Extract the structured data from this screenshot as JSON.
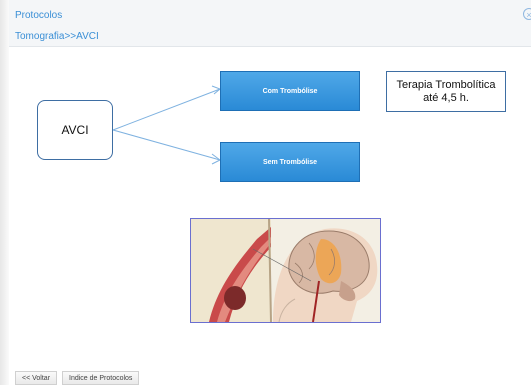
{
  "header": {
    "title": "Protocolos",
    "breadcrumb": "Tomografia>>AVCI",
    "close_icon": "close-circle-icon"
  },
  "diagram": {
    "root_label": "AVCI",
    "branch_com_label": "Com Trombólise",
    "branch_sem_label": "Sem Trombólise",
    "note_line1": "Terapia Trombolítica",
    "note_line2": "até 4,5 h.",
    "image_subject": "brain-stroke-illustration"
  },
  "footer": {
    "back_label": "<< Voltar",
    "index_label": "Indice de Protocolos"
  },
  "colors": {
    "link_blue": "#3a8fd6",
    "box_blue": "#2a8ad6",
    "outline": "#3e6ea3"
  }
}
